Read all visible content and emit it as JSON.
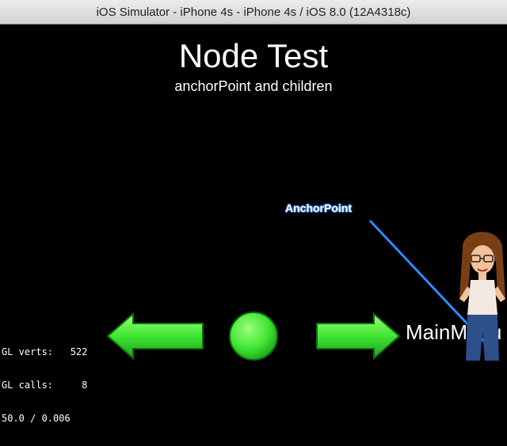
{
  "window": {
    "title": "iOS Simulator - iPhone 4s - iPhone 4s / iOS 8.0 (12A4318c)"
  },
  "scene": {
    "title": "Node Test",
    "subtitle": "anchorPoint and children",
    "anchor_label": "AnchorPoint"
  },
  "stats": {
    "verts": "GL verts:   522",
    "calls": "GL calls:     8",
    "fps": "50.0 / 0.006"
  },
  "menu": {
    "main_label": "MainMenu"
  },
  "colors": {
    "button_green": "#3fe633",
    "arrow_blue": "#2b8cff"
  }
}
